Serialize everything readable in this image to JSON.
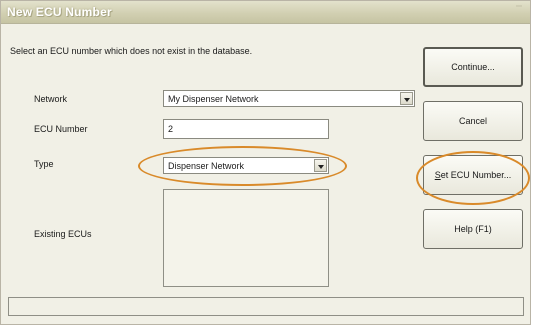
{
  "window": {
    "title": "New ECU Number"
  },
  "instruction": "Select an ECU number which does not exist in the database.",
  "form": {
    "network": {
      "label": "Network",
      "value": "My Dispenser Network"
    },
    "ecu_number": {
      "label": "ECU Number",
      "value": "2"
    },
    "type": {
      "label": "Type",
      "value": "Dispenser Network"
    },
    "existing_ecus": {
      "label": "Existing ECUs",
      "items": []
    }
  },
  "buttons": {
    "continue": "Continue...",
    "cancel": "Cancel",
    "set_ecu_number_first": "S",
    "set_ecu_number_rest": "et ECU Number...",
    "help": "Help (F1)"
  },
  "status_bar": {
    "text": ""
  },
  "colors": {
    "highlight_ellipse": "#d98a2a",
    "title_bar": "#d2d0b2"
  }
}
